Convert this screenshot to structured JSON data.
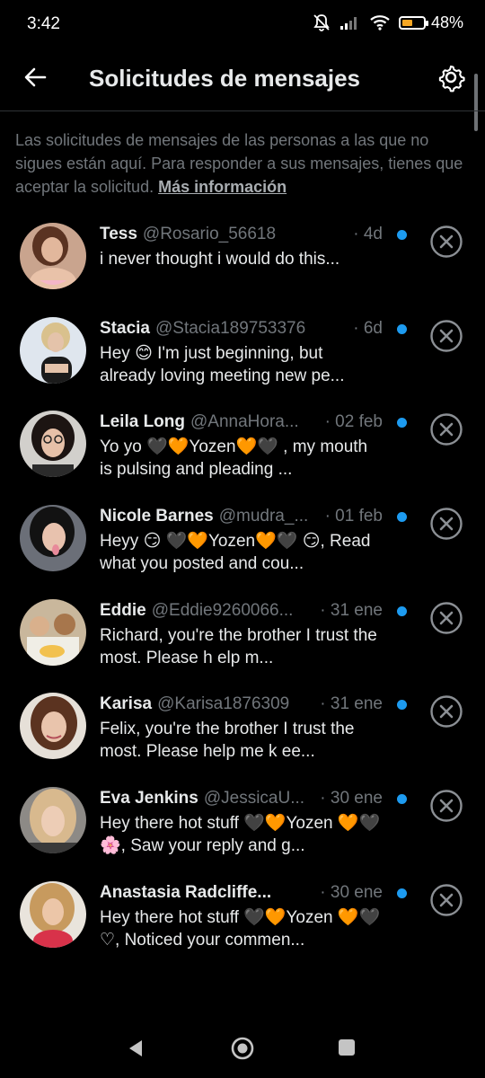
{
  "status_bar": {
    "time": "3:42",
    "battery_percent": "48%",
    "battery_level": 0.48,
    "icons": [
      "mute-icon",
      "signal-icon",
      "wifi-icon",
      "battery-icon"
    ]
  },
  "header": {
    "title": "Solicitudes de mensajes",
    "back_icon": "arrow-left-icon",
    "settings_icon": "gear-icon"
  },
  "info": {
    "text": "Las solicitudes de mensajes de las personas a las que no sigues están aquí. Para responder a sus mensajes, tienes que aceptar la solicitud. ",
    "link": "Más información"
  },
  "colors": {
    "background": "#000000",
    "accent": "#1d9bf0",
    "secondary_text": "#71767b"
  },
  "requests": [
    {
      "name": "Tess",
      "handle": "@Rosario_56618",
      "time": "· 4d",
      "preview": "i never thought i would do this...",
      "unread": true
    },
    {
      "name": "Stacia",
      "handle": "@Stacia189753376",
      "time": "· 6d",
      "preview": "Hey 😊 I'm just beginning, but already loving meeting new pe...",
      "unread": true
    },
    {
      "name": "Leila Long",
      "handle": "@AnnaHora...",
      "time": "· 02 feb",
      "preview": "Yo yo 🖤🧡Yozen🧡🖤  , my mouth is pulsing and pleading ...",
      "unread": true
    },
    {
      "name": "Nicole Barnes",
      "handle": "@mudra_...",
      "time": "· 01 feb",
      "preview": "Heyy 😏 🖤🧡Yozen🧡🖤 😏, Read what you posted and cou...",
      "unread": true
    },
    {
      "name": "Eddie",
      "handle": "@Eddie9260066...",
      "time": "· 31 ene",
      "preview": "Richard, you're the brother I trust the most. Please h elp m...",
      "unread": true
    },
    {
      "name": "Karisa",
      "handle": "@Karisa1876309",
      "time": "· 31 ene",
      "preview": "Felix, you're the brother I  trust the most. Please help me k ee...",
      "unread": true
    },
    {
      "name": "Eva Jenkins",
      "handle": "@JessicaU...",
      "time": "· 30 ene",
      "preview": "Hey there hot stuff 🖤🧡Yozen 🧡🖤 🌸, Saw your reply and g...",
      "unread": true
    },
    {
      "name": "Anastasia Radcliffe...",
      "handle": "",
      "time": "· 30 ene",
      "preview": "Hey there hot stuff 🖤🧡Yozen 🧡🖤 ♡, Noticed your commen...",
      "unread": true
    }
  ],
  "nav_bar": {
    "icons": [
      "nav-back-icon",
      "nav-home-icon",
      "nav-recents-icon"
    ]
  }
}
